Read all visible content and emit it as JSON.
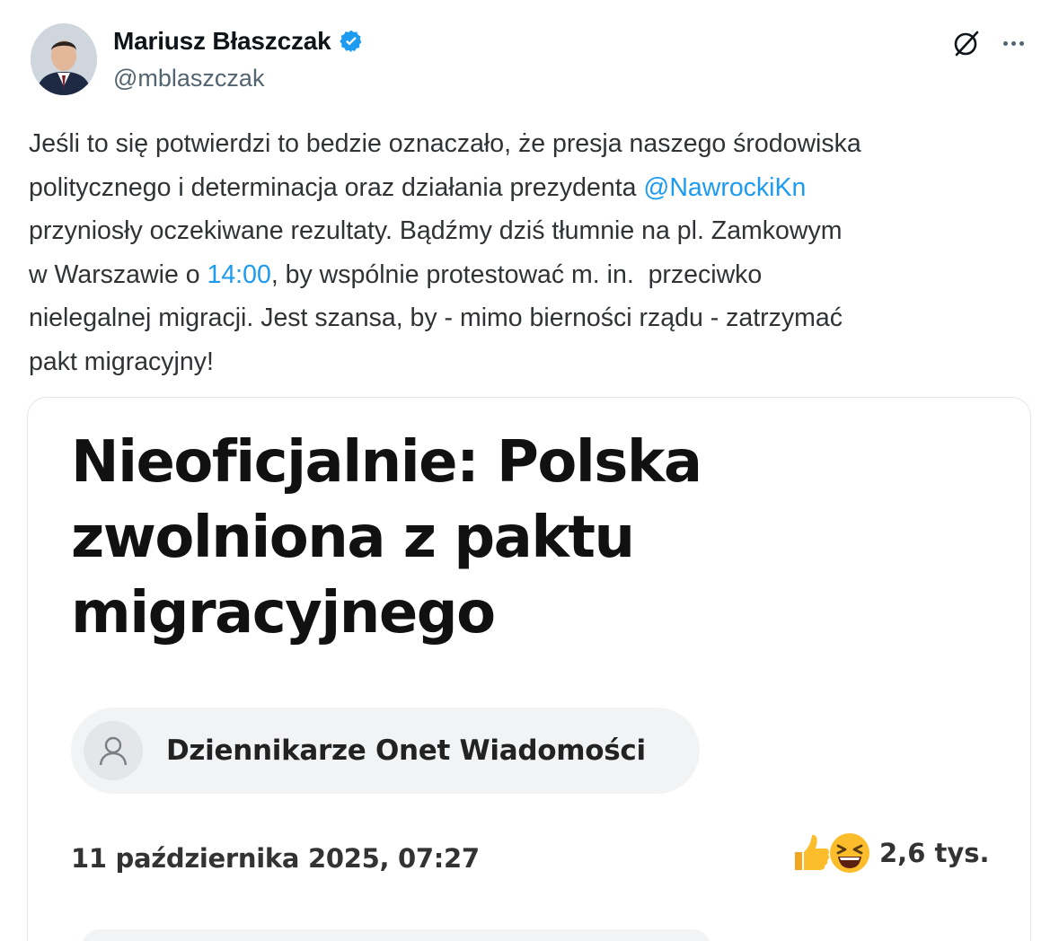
{
  "author": {
    "display_name": "Mariusz Błaszczak",
    "handle": "@mblaszczak",
    "verified": true,
    "verified_color": "#1d9bf0"
  },
  "actions": {
    "grok_icon": "grok-icon",
    "more_icon": "more-options-icon"
  },
  "tweet": {
    "lines": [
      [
        {
          "text": "Jeśli to się potwierdzi to bedzie oznaczało, że presja naszego środowiska"
        }
      ],
      [
        {
          "text": "politycznego i determinacja oraz działania prezydenta "
        },
        {
          "text": "@NawrockiKn",
          "link": true
        }
      ],
      [
        {
          "text": "przyniosły oczekiwane rezultaty. Bądźmy dziś tłumnie na pl. Zamkowym"
        }
      ],
      [
        {
          "text": "w Warszawie o "
        },
        {
          "text": "14:00",
          "link": true
        },
        {
          "text": ", by wspólnie protestować m. in.  przeciwko"
        }
      ],
      [
        {
          "text": "nielegalnej migracji. Jest szansa, by - mimo bierności rządu - zatrzymać"
        }
      ],
      [
        {
          "text": "pakt migracyjny!"
        }
      ]
    ],
    "link_color": "#1d9bf0"
  },
  "card": {
    "headline_lines": [
      "Nieoficjalnie: Polska",
      "zwolniona z paktu",
      "migracyjnego"
    ],
    "author_name": "Dziennikarze Onet Wiadomości",
    "date": "11 października 2025, 07:27",
    "reactions": [
      "thumbs-up-emoji",
      "laughing-emoji"
    ],
    "reaction_count": "2,6 tys."
  }
}
